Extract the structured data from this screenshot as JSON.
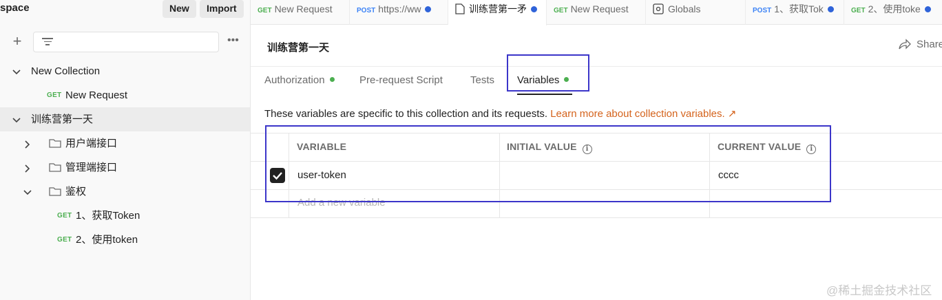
{
  "sidebar": {
    "workspace_name": "space",
    "new_button": "New",
    "import_button": "Import",
    "more_icon": "•••",
    "plus_icon": "+",
    "tree": [
      {
        "type": "collection",
        "label": "New Collection",
        "expanded": true
      },
      {
        "type": "request",
        "method": "GET",
        "label": "New Request"
      },
      {
        "type": "collection",
        "label": "训练营第一天",
        "expanded": true,
        "selected": true
      },
      {
        "type": "folder",
        "label": "用户端接口",
        "expanded": false
      },
      {
        "type": "folder",
        "label": "管理端接口",
        "expanded": false
      },
      {
        "type": "folder",
        "label": "鉴权",
        "expanded": true
      },
      {
        "type": "request",
        "method": "GET",
        "label": "1、获取Token"
      },
      {
        "type": "request",
        "method": "GET",
        "label": "2、使用token"
      }
    ]
  },
  "tabs": [
    {
      "method": "GET",
      "label": "New Request",
      "dot": false
    },
    {
      "method": "POST",
      "label": "https://ww",
      "dot": true
    },
    {
      "method": "",
      "label": "训练营第一矛",
      "dot": true,
      "active": true,
      "icon": "document-icon"
    },
    {
      "method": "GET",
      "label": "New Request",
      "dot": false
    },
    {
      "method": "",
      "label": "Globals",
      "dot": false,
      "icon": "globals-icon"
    },
    {
      "method": "POST",
      "label": "1、获取Tok",
      "dot": true
    },
    {
      "method": "GET",
      "label": "2、使用toke",
      "dot": true
    }
  ],
  "main": {
    "title": "训练营第一天",
    "share_label": "Share",
    "subtabs": [
      {
        "label": "Authorization",
        "dot": true
      },
      {
        "label": "Pre-request Script",
        "dot": false
      },
      {
        "label": "Tests",
        "dot": false
      },
      {
        "label": "Variables",
        "dot": true,
        "active": true
      }
    ],
    "description": "These variables are specific to this collection and its requests.",
    "learn_more": "Learn more about collection variables. ↗",
    "table": {
      "headers": [
        "VARIABLE",
        "INITIAL VALUE",
        "CURRENT VALUE"
      ],
      "rows": [
        {
          "checked": true,
          "variable": "user-token",
          "initial_value": "",
          "current_value": "cccc"
        }
      ],
      "add_placeholder": "Add a new variable"
    }
  },
  "watermark": "@稀土掘金技术社区",
  "colors": {
    "highlight": "#3b35c9",
    "get_method": "#4caf50",
    "post_method": "#3b82f6",
    "link": "#d4621b",
    "unsaved_dot": "#2f63d9"
  }
}
